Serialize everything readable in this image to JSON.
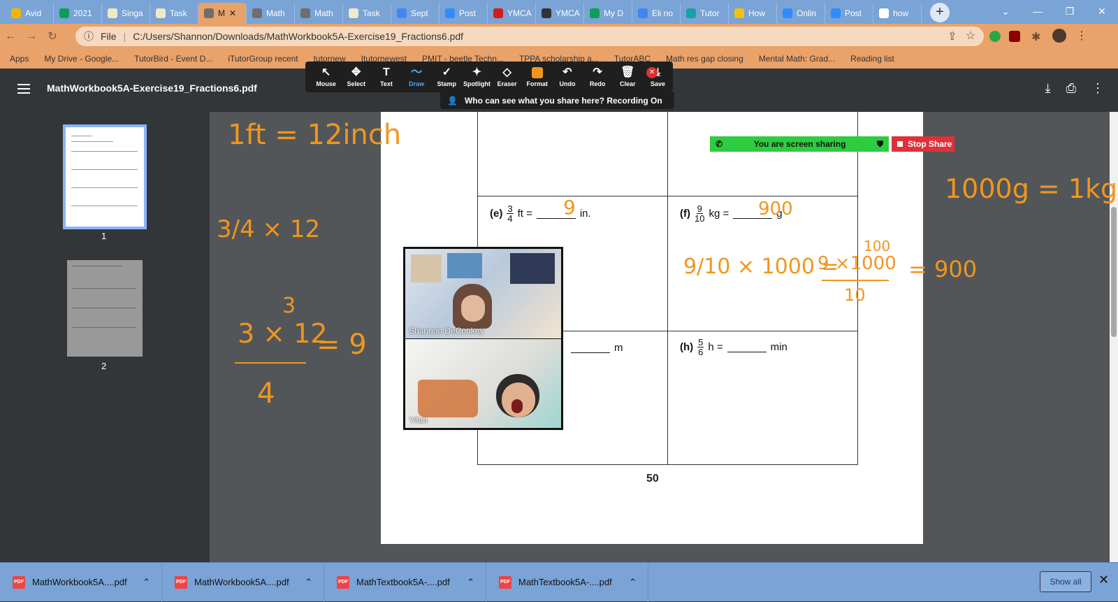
{
  "browser": {
    "tabs": [
      {
        "label": "Avid",
        "color": "#f4b400"
      },
      {
        "label": "2021",
        "color": "#0f9d58"
      },
      {
        "label": "Singa",
        "color": "#f1e9c6"
      },
      {
        "label": "Task",
        "color": "#f1e9c6"
      },
      {
        "label": "M",
        "color": "#6e6e6e",
        "active": true
      },
      {
        "label": "Math",
        "color": "#6e6e6e"
      },
      {
        "label": "Math",
        "color": "#6e6e6e"
      },
      {
        "label": "Task",
        "color": "#f1e9c6"
      },
      {
        "label": "Sept",
        "color": "#4285f4"
      },
      {
        "label": "Post",
        "color": "#2d8cff"
      },
      {
        "label": "YMCA",
        "color": "#d21c1c"
      },
      {
        "label": "YMCA",
        "color": "#333333"
      },
      {
        "label": "My D",
        "color": "#0f9d58"
      },
      {
        "label": "Eli no",
        "color": "#4285f4"
      },
      {
        "label": "Tutor",
        "color": "#16a3a3"
      },
      {
        "label": "How",
        "color": "#f4c20d"
      },
      {
        "label": "Onlin",
        "color": "#2d8cff"
      },
      {
        "label": "Post",
        "color": "#2d8cff"
      },
      {
        "label": "how",
        "color": "#ffffff"
      }
    ],
    "new_tab": "+",
    "url_scheme": "File",
    "url": "C:/Users/Shannon/Downloads/MathWorkbook5A-Exercise19_Fractions6.pdf",
    "bookmarks": [
      "Apps",
      "My Drive - Google...",
      "TutorBird - Event D...",
      "iTutorGroup recent",
      "tutornew",
      "Itutornewest",
      "PMIT - beetle Techn...",
      "TPPA scholarship a...",
      "TutorABC",
      "Math res gap closing",
      "Mental Math: Grad...",
      "Reading list"
    ]
  },
  "viewer": {
    "title": "MathWorkbook5A-Exercise19_Fractions6.pdf",
    "page_labels": [
      "1",
      "2"
    ]
  },
  "annotation": {
    "tools": [
      {
        "label": "Mouse",
        "glyph": "↖"
      },
      {
        "label": "Select",
        "glyph": "✥"
      },
      {
        "label": "Text",
        "glyph": "T"
      },
      {
        "label": "Draw",
        "glyph": "〜",
        "selected": true
      },
      {
        "label": "Stamp",
        "glyph": "✓"
      },
      {
        "label": "Spotlight",
        "glyph": "✦"
      },
      {
        "label": "Eraser",
        "glyph": "◇"
      },
      {
        "label": "Format",
        "glyph": ""
      },
      {
        "label": "Undo",
        "glyph": "↶"
      },
      {
        "label": "Redo",
        "glyph": "↷"
      },
      {
        "label": "Clear",
        "glyph": "🗑"
      },
      {
        "label": "Save",
        "glyph": "⤓"
      }
    ],
    "recording_notice": "Who can see what you share here? Recording On",
    "accent": "#f0961f"
  },
  "share": {
    "status": "You are screen sharing",
    "stop_label": "Stop Share"
  },
  "video": {
    "participants": [
      "Shannon DeConkey",
      "Yifan"
    ]
  },
  "worksheet": {
    "e": {
      "label": "(e)",
      "num": "3",
      "den": "4",
      "unit1": "ft =",
      "unit2": "in."
    },
    "f": {
      "label": "(f)",
      "num": "9",
      "den": "10",
      "unit1": "kg =",
      "unit2": "g"
    },
    "g": {
      "unit2": "m"
    },
    "h": {
      "label": "(h)",
      "num": "5",
      "den": "6",
      "unit1": "h =",
      "unit2": "min"
    },
    "page_number": "50"
  },
  "handwriting": {
    "note1": "1ft = 12inch",
    "note2": "1000g = 1kg",
    "e_answer": "9",
    "f_answer": "900",
    "left_work_1": "3/4 × 12",
    "left_work_2a": "3",
    "left_work_2b": "3 × 12",
    "left_work_2c": "= 9",
    "left_work_2d": "4",
    "f_work_a": "9/10 × 1000 =",
    "f_work_b": "100",
    "f_work_c": "9 ×1000",
    "f_work_d": "10",
    "f_work_e": "= 900"
  },
  "downloads": {
    "items": [
      "MathWorkbook5A....pdf",
      "MathWorkbook5A....pdf",
      "MathTextbook5A-....pdf",
      "MathTextbook5A-....pdf"
    ],
    "show_all": "Show all"
  }
}
